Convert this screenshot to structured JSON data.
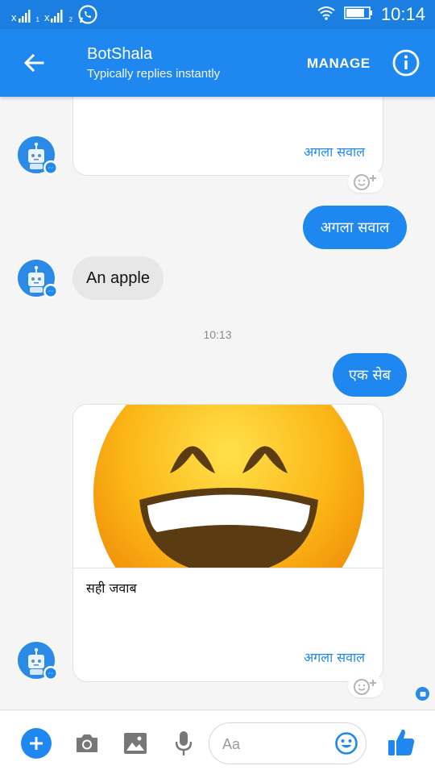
{
  "status_bar": {
    "sim1_label": "x",
    "sim1_sub": "1",
    "sim2_label": "x",
    "sim2_sub": "2",
    "time": "10:14"
  },
  "header": {
    "title": "BotShala",
    "subtitle": "Typically replies instantly",
    "manage_label": "MANAGE"
  },
  "messages": {
    "card1_button": "अगला सवाल",
    "out1": "अगला सवाल",
    "in1": "An apple",
    "timestamp": "10:13",
    "out2": "एक सेब",
    "card2_text": "सही जवाब",
    "card2_button": "अगला सवाल"
  },
  "composer": {
    "placeholder": "Aa"
  },
  "colors": {
    "accent": "#1e88f0",
    "statusbar": "#1a7fe0",
    "incoming_bubble": "#e7e7e7"
  }
}
